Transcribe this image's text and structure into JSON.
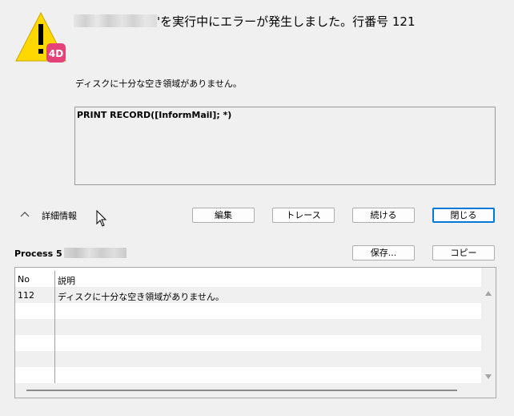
{
  "header": {
    "title_suffix": "'を実行中にエラーが発生しました。行番号 121",
    "message": "ディスクに十分な空き領域がありません。",
    "badge": "4D"
  },
  "code": {
    "statement": "PRINT RECORD([InformMail]; *)"
  },
  "details": {
    "toggle_label": "詳細情報"
  },
  "buttons": {
    "edit": "編集",
    "trace": "トレース",
    "continue": "続ける",
    "close": "閉じる",
    "save": "保存...",
    "copy": "コピー"
  },
  "process": {
    "label": "Process 5"
  },
  "table": {
    "columns": [
      "No",
      "説明"
    ],
    "rows": [
      {
        "no": "112",
        "description": "ディスクに十分な空き領域がありません。"
      }
    ]
  },
  "colors": {
    "warning": "#ffd800",
    "badge": "#e6427a",
    "default_button_border": "#0078d7"
  },
  "icons": [
    "warning-icon",
    "4d-badge-icon",
    "chevron-up-icon",
    "mouse-cursor-icon",
    "scroll-up-icon",
    "scroll-down-icon"
  ]
}
